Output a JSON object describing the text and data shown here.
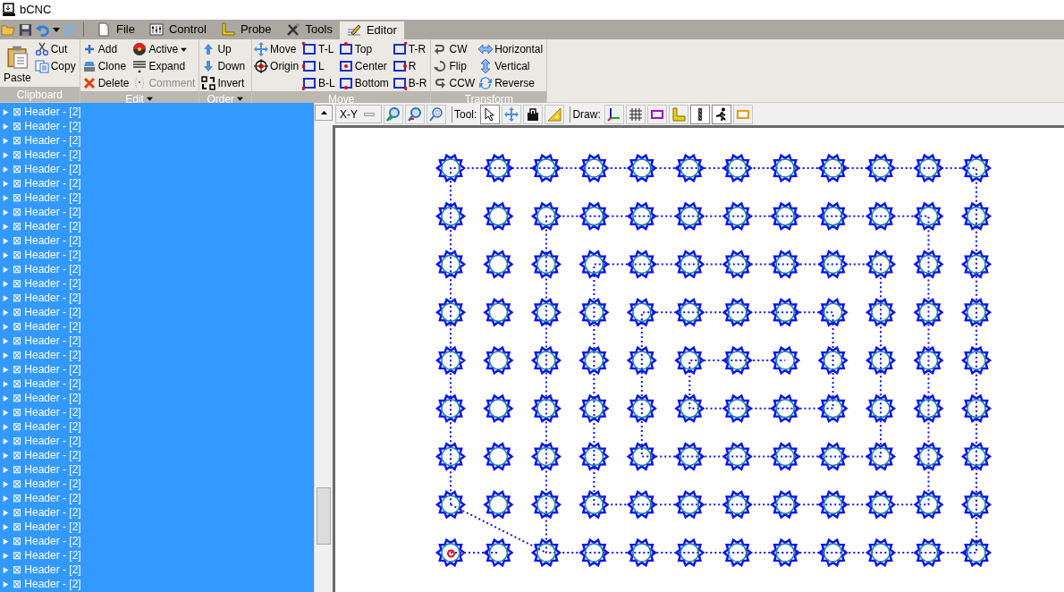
{
  "window": {
    "title": "bCNC"
  },
  "tabs": [
    {
      "label": "File",
      "selected": false
    },
    {
      "label": "Control",
      "selected": false
    },
    {
      "label": "Probe",
      "selected": false
    },
    {
      "label": "Tools",
      "selected": false
    },
    {
      "label": "Editor",
      "selected": true
    }
  ],
  "ribbon_groups": [
    {
      "label": "Clipboard",
      "has_menu": false,
      "columns": [
        [
          {
            "label": "Paste",
            "kind": "large",
            "disabled": false
          }
        ],
        [
          {
            "label": "Cut",
            "kind": "small",
            "disabled": false
          },
          {
            "label": "Copy",
            "kind": "small",
            "disabled": false
          }
        ]
      ]
    },
    {
      "label": "Edit",
      "has_menu": true,
      "columns": [
        [
          {
            "label": "Add",
            "kind": "small",
            "disabled": false
          },
          {
            "label": "Clone",
            "kind": "small",
            "disabled": false
          },
          {
            "label": "Delete",
            "kind": "small",
            "disabled": false
          }
        ],
        [
          {
            "label": "Active",
            "kind": "menu",
            "disabled": false
          },
          {
            "label": "Expand",
            "kind": "small",
            "disabled": false
          },
          {
            "label": "Comment",
            "kind": "small",
            "disabled": true
          }
        ]
      ]
    },
    {
      "label": "Order",
      "has_menu": true,
      "columns": [
        [
          {
            "label": "Up",
            "kind": "small",
            "disabled": false
          },
          {
            "label": "Down",
            "kind": "small",
            "disabled": false
          },
          {
            "label": "Invert",
            "kind": "small",
            "disabled": false
          }
        ]
      ]
    },
    {
      "label": "Move",
      "has_menu": false,
      "columns": [
        [
          {
            "label": "Move",
            "kind": "small",
            "disabled": false
          },
          {
            "label": "Origin",
            "kind": "small",
            "disabled": false
          }
        ],
        [
          {
            "label": "T-L",
            "kind": "small",
            "disabled": false
          },
          {
            "label": "L",
            "kind": "small",
            "disabled": false
          },
          {
            "label": "B-L",
            "kind": "small",
            "disabled": false
          }
        ],
        [
          {
            "label": "Top",
            "kind": "small",
            "disabled": false
          },
          {
            "label": "Center",
            "kind": "small",
            "disabled": false
          },
          {
            "label": "Bottom",
            "kind": "small",
            "disabled": false
          }
        ],
        [
          {
            "label": "T-R",
            "kind": "small",
            "disabled": false
          },
          {
            "label": "R",
            "kind": "small",
            "disabled": false
          },
          {
            "label": "B-R",
            "kind": "small",
            "disabled": false
          }
        ]
      ]
    },
    {
      "label": "Transform",
      "has_menu": false,
      "columns": [
        [
          {
            "label": "CW",
            "kind": "small",
            "disabled": false
          },
          {
            "label": "Flip",
            "kind": "small",
            "disabled": false
          },
          {
            "label": "CCW",
            "kind": "small",
            "disabled": false
          }
        ],
        [
          {
            "label": "Horizontal",
            "kind": "small",
            "disabled": false
          },
          {
            "label": "Vertical",
            "kind": "small",
            "disabled": false
          },
          {
            "label": "Reverse",
            "kind": "small",
            "disabled": false
          }
        ]
      ]
    }
  ],
  "tree": [
    {
      "label": "⊠ Header - [2]",
      "expanded": false,
      "selected": true
    },
    {
      "label": "⊠ Header - [2]",
      "expanded": false,
      "selected": true
    },
    {
      "label": "⊠ Header - [2]",
      "expanded": false,
      "selected": true
    },
    {
      "label": "⊠ Header - [2]",
      "expanded": false,
      "selected": true
    },
    {
      "label": "⊠ Header - [2]",
      "expanded": false,
      "selected": true
    },
    {
      "label": "⊠ Header - [2]",
      "expanded": false,
      "selected": true
    },
    {
      "label": "⊠ Header - [2]",
      "expanded": false,
      "selected": true
    },
    {
      "label": "⊠ Header - [2]",
      "expanded": false,
      "selected": true
    },
    {
      "label": "⊠ Header - [2]",
      "expanded": false,
      "selected": true
    },
    {
      "label": "⊠ Header - [2]",
      "expanded": false,
      "selected": true
    },
    {
      "label": "⊠ Header - [2]",
      "expanded": false,
      "selected": true
    },
    {
      "label": "⊠ Header - [2]",
      "expanded": false,
      "selected": true
    },
    {
      "label": "⊠ Header - [2]",
      "expanded": false,
      "selected": true
    },
    {
      "label": "⊠ Header - [2]",
      "expanded": false,
      "selected": true
    },
    {
      "label": "⊠ Header - [2]",
      "expanded": false,
      "selected": true
    },
    {
      "label": "⊠ Header - [2]",
      "expanded": false,
      "selected": true
    },
    {
      "label": "⊠ Header - [2]",
      "expanded": false,
      "selected": true
    },
    {
      "label": "⊠ Header - [2]",
      "expanded": false,
      "selected": true
    },
    {
      "label": "⊠ Header - [2]",
      "expanded": false,
      "selected": true
    },
    {
      "label": "⊠ Header - [2]",
      "expanded": false,
      "selected": true
    },
    {
      "label": "⊠ Header - [2]",
      "expanded": false,
      "selected": true
    },
    {
      "label": "⊠ Header - [2]",
      "expanded": false,
      "selected": true
    },
    {
      "label": "⊠ Header - [2]",
      "expanded": false,
      "selected": true
    },
    {
      "label": "⊠ Header - [2]",
      "expanded": false,
      "selected": true
    },
    {
      "label": "⊠ Header - [2]",
      "expanded": false,
      "selected": true
    },
    {
      "label": "⊠ Header - [2]",
      "expanded": false,
      "selected": true
    },
    {
      "label": "⊠ Header - [2]",
      "expanded": false,
      "selected": true
    },
    {
      "label": "⊠ Header - [2]",
      "expanded": false,
      "selected": true
    },
    {
      "label": "⊠ Header - [2]",
      "expanded": false,
      "selected": true
    },
    {
      "label": "⊠ Header - [2]",
      "expanded": false,
      "selected": true
    },
    {
      "label": "⊠ Header - [2]",
      "expanded": false,
      "selected": true
    },
    {
      "label": "⊠ Header - [2]",
      "expanded": false,
      "selected": true
    },
    {
      "label": "⊠ Header - [2]",
      "expanded": false,
      "selected": true
    },
    {
      "label": "⊠ Header - [2]",
      "expanded": false,
      "selected": true
    }
  ],
  "canvas_toolbar": {
    "view": "X-Y",
    "tool_label": "Tool:",
    "draw_label": "Draw:",
    "tools": [
      {
        "kind": "select",
        "selected": true
      },
      {
        "kind": "pan",
        "selected": false
      },
      {
        "kind": "gantry",
        "selected": false
      },
      {
        "kind": "ruler",
        "selected": false
      }
    ],
    "draw": [
      {
        "kind": "axes",
        "on": false
      },
      {
        "kind": "grid",
        "on": false
      },
      {
        "kind": "margin",
        "on": false
      },
      {
        "kind": "probe",
        "on": false
      },
      {
        "kind": "paths",
        "on": true
      },
      {
        "kind": "rapid",
        "on": true
      },
      {
        "kind": "workarea",
        "on": false
      }
    ]
  }
}
